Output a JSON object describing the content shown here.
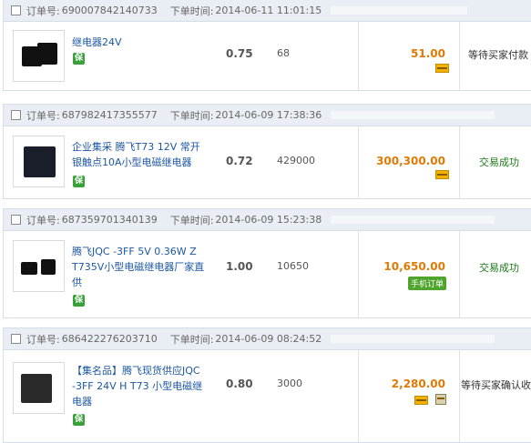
{
  "order_label": "订单号:",
  "time_label": "下单时间:",
  "bao_text": "保",
  "orders": [
    {
      "order_no": "690007842140733",
      "time": "2014-06-11 11:01:15",
      "product": "继电器24V",
      "price": "0.75",
      "qty": "68",
      "total": "51.00",
      "status": "等待买家付款",
      "icon": "card-icon"
    },
    {
      "order_no": "687982417355577",
      "time": "2014-06-09 17:38:36",
      "product": "企业集采 腾飞T73 12V 常开银触点10A小型电磁继电器",
      "price": "0.72",
      "qty": "429000",
      "total": "300,300.00",
      "status": "交易成功",
      "icon": "card-icon"
    },
    {
      "order_no": "687359701340139",
      "time": "2014-06-09 15:23:38",
      "product": "腾飞JQC -3FF 5V 0.36W Z T735V小型电磁继电器厂家直供",
      "price": "1.00",
      "qty": "10650",
      "total": "10,650.00",
      "status": "交易成功",
      "badge": "手机订单"
    },
    {
      "order_no": "686422276203710",
      "time": "2014-06-09 08:24:52",
      "product": "【集名品】腾飞现货供应JQC -3FF 24V H T73 小型电磁继电器",
      "price": "0.80",
      "qty": "3000",
      "total": "2,280.00",
      "status": "等待买家确认收货",
      "icon": "card-icon"
    }
  ]
}
